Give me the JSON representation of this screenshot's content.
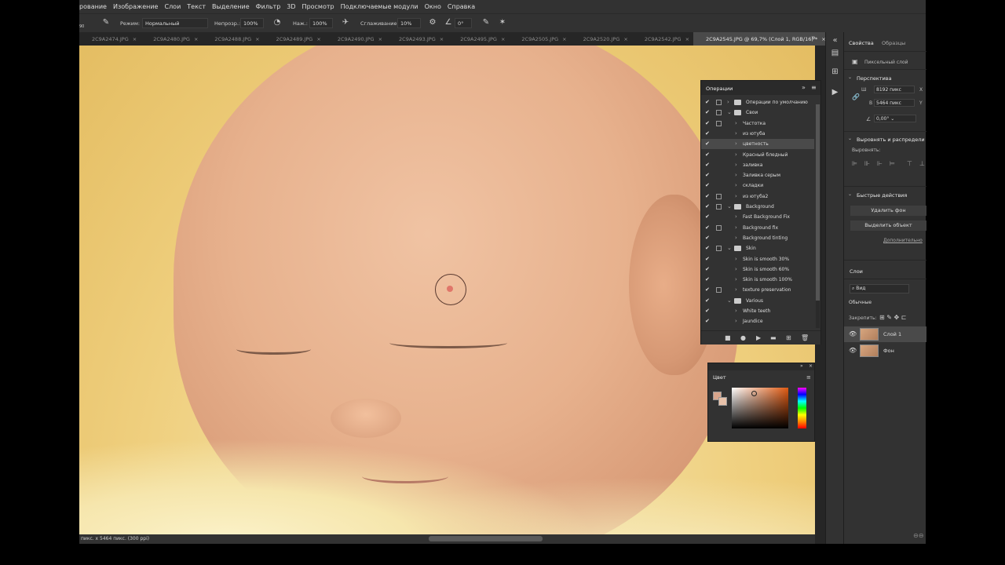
{
  "menu": [
    "рование",
    "Изображение",
    "Слои",
    "Текст",
    "Выделение",
    "Фильтр",
    "3D",
    "Просмотр",
    "Подключаемые модули",
    "Окно",
    "Справка"
  ],
  "options": {
    "mode_label": "Режим:",
    "mode_value": "Нормальный",
    "opacity_label": "Непрозр.:",
    "opacity_value": "100%",
    "pressure_label": "Наж.:",
    "pressure_value": "100%",
    "smoothing_label": "Сглаживание:",
    "smoothing_value": "10%",
    "angle_value": "0°",
    "brush_size": "90"
  },
  "tabs": [
    {
      "label": "2C9A2474.JPG",
      "active": false
    },
    {
      "label": "2C9A2480.JPG",
      "active": false
    },
    {
      "label": "2C9A2488.JPG",
      "active": false
    },
    {
      "label": "2C9A2489.JPG",
      "active": false
    },
    {
      "label": "2C9A2490.JPG",
      "active": false
    },
    {
      "label": "2C9A2493.JPG",
      "active": false
    },
    {
      "label": "2C9A2495.JPG",
      "active": false
    },
    {
      "label": "2C9A2505.JPG",
      "active": false
    },
    {
      "label": "2C9A2520.JPG",
      "active": false
    },
    {
      "label": "2C9A2542.JPG",
      "active": false
    },
    {
      "label": "2C9A2545.JPG @ 69,7% (Слой 1, RGB/16) *",
      "active": true
    }
  ],
  "status": {
    "doc_info": "пикс. x 5464 пикс. (300 ppi)"
  },
  "properties": {
    "tab_properties": "Свойства",
    "tab_swatches": "Образцы",
    "layer_kind": "Пиксельный слой",
    "perspective_head": "Перспектива",
    "w_label": "Ш",
    "w_value": "8192 пикс",
    "x_label": "X",
    "h_label": "В",
    "h_value": "5464 пикс",
    "y_label": "Y",
    "angle": "0,00°",
    "align_head": "Выровнять и распредели",
    "align_sub": "Выровнять:",
    "quick_head": "Быстрые действия",
    "btn_remove_bg": "Удалить фон",
    "btn_select_subject": "Выделить объект",
    "more_link": "Дополнительно"
  },
  "layers": {
    "head": "Слои",
    "search": "Вид",
    "blend": "Обычные",
    "lock_label": "Закрепить:",
    "items": [
      {
        "name": "Слой 1",
        "selected": true
      },
      {
        "name": "Фон",
        "selected": false
      }
    ]
  },
  "actions": {
    "title": "Операции",
    "items": [
      {
        "label": "Операции по умолчанию",
        "level": 0,
        "type": "set",
        "open": false,
        "box": true
      },
      {
        "label": "Свои",
        "level": 0,
        "type": "set",
        "open": true,
        "box": true
      },
      {
        "label": "Частотка",
        "level": 1,
        "type": "action",
        "box": true
      },
      {
        "label": "из ютуба",
        "level": 1,
        "type": "action",
        "box": false
      },
      {
        "label": "цветность",
        "level": 1,
        "type": "action",
        "box": false,
        "highlighted": true
      },
      {
        "label": "Красный бледный",
        "level": 1,
        "type": "action",
        "box": false
      },
      {
        "label": "заливка",
        "level": 1,
        "type": "action",
        "box": false
      },
      {
        "label": "Заливка серым",
        "level": 1,
        "type": "action",
        "box": false
      },
      {
        "label": "складки",
        "level": 1,
        "type": "action",
        "box": false
      },
      {
        "label": "из ютуба2",
        "level": 1,
        "type": "action",
        "box": true
      },
      {
        "label": "Background",
        "level": 0,
        "type": "set",
        "open": true,
        "box": true
      },
      {
        "label": "Fast Background Fix",
        "level": 1,
        "type": "action",
        "box": false
      },
      {
        "label": "Background fix",
        "level": 1,
        "type": "action",
        "box": true
      },
      {
        "label": "Background tinting",
        "level": 1,
        "type": "action",
        "box": false
      },
      {
        "label": "Skin",
        "level": 0,
        "type": "set",
        "open": true,
        "box": true
      },
      {
        "label": "Skin is smooth 30%",
        "level": 1,
        "type": "action",
        "box": false
      },
      {
        "label": "Skin is smooth 60%",
        "level": 1,
        "type": "action",
        "box": false
      },
      {
        "label": "Skin is smooth 100%",
        "level": 1,
        "type": "action",
        "box": false
      },
      {
        "label": "texture preservation",
        "level": 1,
        "type": "action",
        "box": true
      },
      {
        "label": "Various",
        "level": 0,
        "type": "set",
        "open": true,
        "box": false
      },
      {
        "label": "White teeth",
        "level": 1,
        "type": "action",
        "box": false
      },
      {
        "label": "Jaundice",
        "level": 1,
        "type": "action",
        "box": false
      }
    ]
  },
  "color_panel": {
    "title": "Цвет",
    "foreground": "#d8a58c",
    "background": "#e8c2aa"
  },
  "colors": {
    "ui_dark": "#323232",
    "ui_darker": "#262626",
    "active_tab": "#4a4a4a"
  }
}
